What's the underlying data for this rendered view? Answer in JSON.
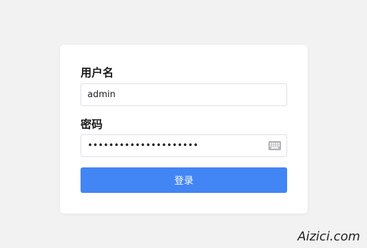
{
  "login_form": {
    "username_label": "用户名",
    "username_value": "admin",
    "password_label": "密码",
    "password_value": "•••••••••••••••••••••",
    "password_icon": "keyboard-icon",
    "submit_label": "登录"
  },
  "watermark": {
    "text": "Aizici.com"
  },
  "colors": {
    "page_background": "#f2f2f2",
    "card_background": "#ffffff",
    "input_border": "#dcdfe6",
    "button_background": "#4285f4",
    "button_text": "#ffffff",
    "label_text": "#1a1a1a"
  }
}
